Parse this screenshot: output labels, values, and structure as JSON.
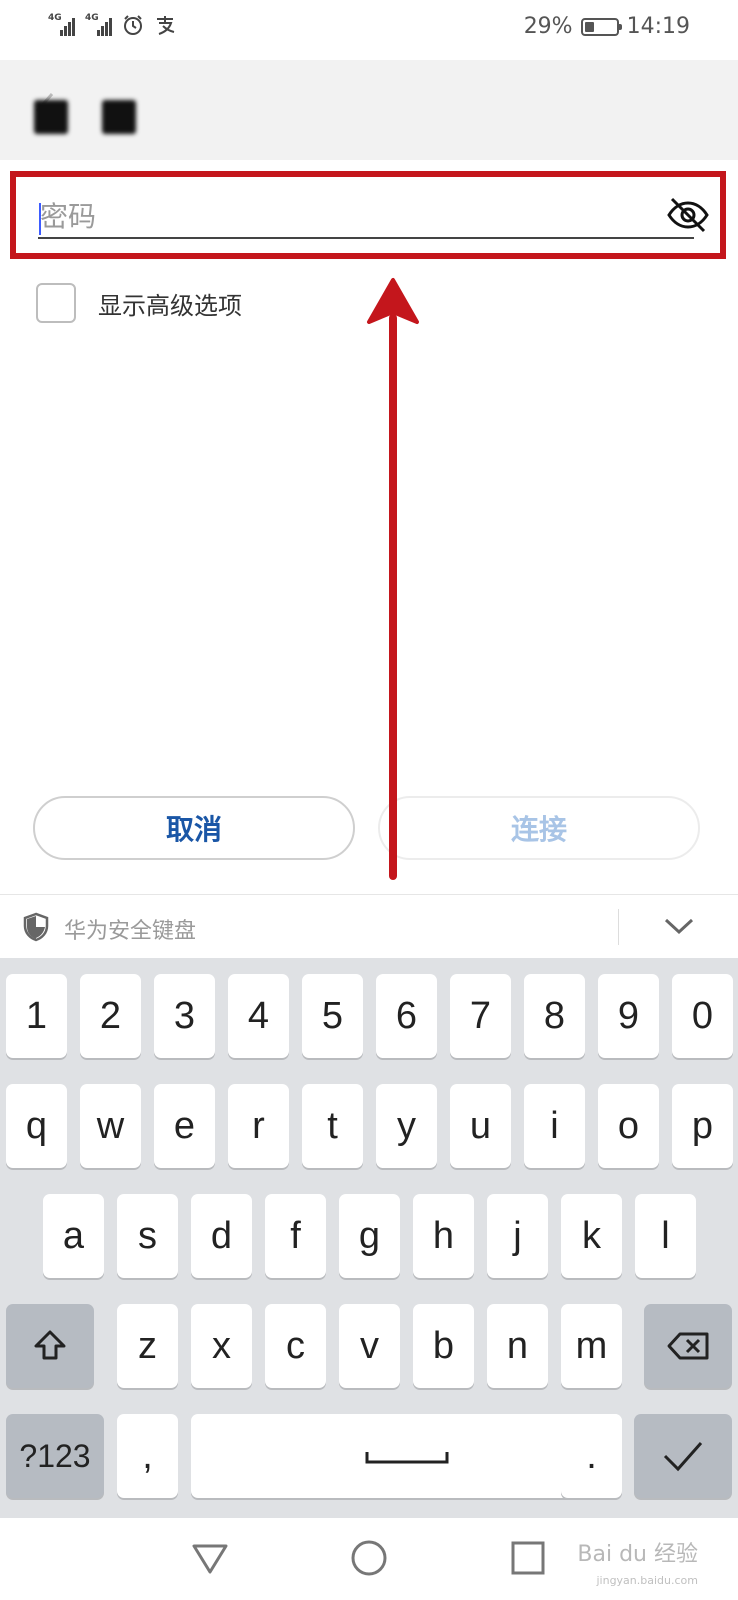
{
  "status_bar": {
    "network_1": "4G",
    "network_2": "4G",
    "battery_percent": "29%",
    "battery_level": 0.29,
    "time": "14:19"
  },
  "password_field": {
    "placeholder": "密码",
    "value": ""
  },
  "advanced": {
    "label": "显示高级选项",
    "checked": false
  },
  "buttons": {
    "cancel": "取消",
    "connect": "连接"
  },
  "keyboard": {
    "title": "华为安全键盘",
    "rows": [
      [
        "1",
        "2",
        "3",
        "4",
        "5",
        "6",
        "7",
        "8",
        "9",
        "0"
      ],
      [
        "q",
        "w",
        "e",
        "r",
        "t",
        "y",
        "u",
        "i",
        "o",
        "p"
      ],
      [
        "a",
        "s",
        "d",
        "f",
        "g",
        "h",
        "j",
        "k",
        "l"
      ],
      [
        "z",
        "x",
        "c",
        "v",
        "b",
        "n",
        "m"
      ]
    ],
    "symbols_key": "?123",
    "comma_key": ",",
    "period_key": "."
  },
  "watermark": {
    "text": "Bai du 经验",
    "sub": "jingyan.baidu.com"
  },
  "colors": {
    "highlight_red": "#c4161c",
    "cancel_blue": "#1a56a6",
    "connect_disabled": "#a8c4e6"
  }
}
